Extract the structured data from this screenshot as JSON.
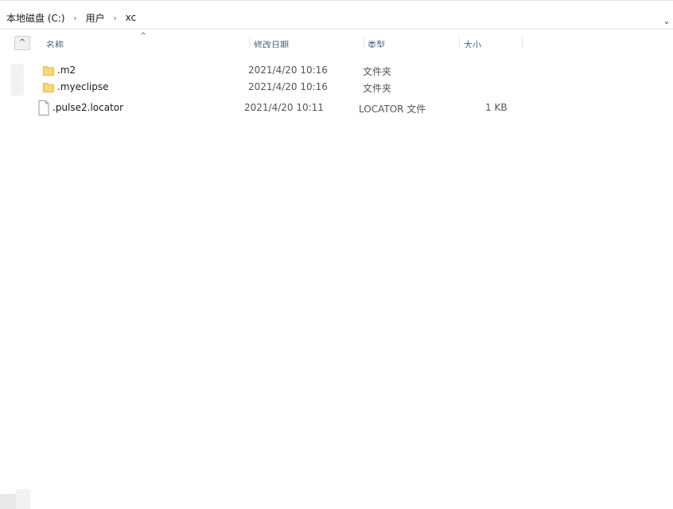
{
  "address": {
    "path": [
      "本地磁盘 (C:)",
      "用户",
      "xc"
    ],
    "dropdown_glyph": "⌄"
  },
  "columns": {
    "name": "名称",
    "date": "修改日期",
    "type": "类型",
    "size": "大小",
    "sort_glyph": "^",
    "up_glyph": "^"
  },
  "files": [
    {
      "name": ".m2",
      "date": "2021/4/20 10:16",
      "type": "文件夹",
      "size": "",
      "icon": "folder-icon"
    },
    {
      "name": ".myeclipse",
      "date": "2021/4/20 10:16",
      "type": "文件夹",
      "size": "",
      "icon": "folder-icon"
    },
    {
      "name": ".pulse2.locator",
      "date": "2021/4/20 10:11",
      "type": "LOCATOR 文件",
      "size": "1 KB",
      "icon": "file-icon"
    }
  ],
  "colors": {
    "folder": "#f8d775",
    "folder_dark": "#e8b94a",
    "header_text": "#4d6082"
  }
}
